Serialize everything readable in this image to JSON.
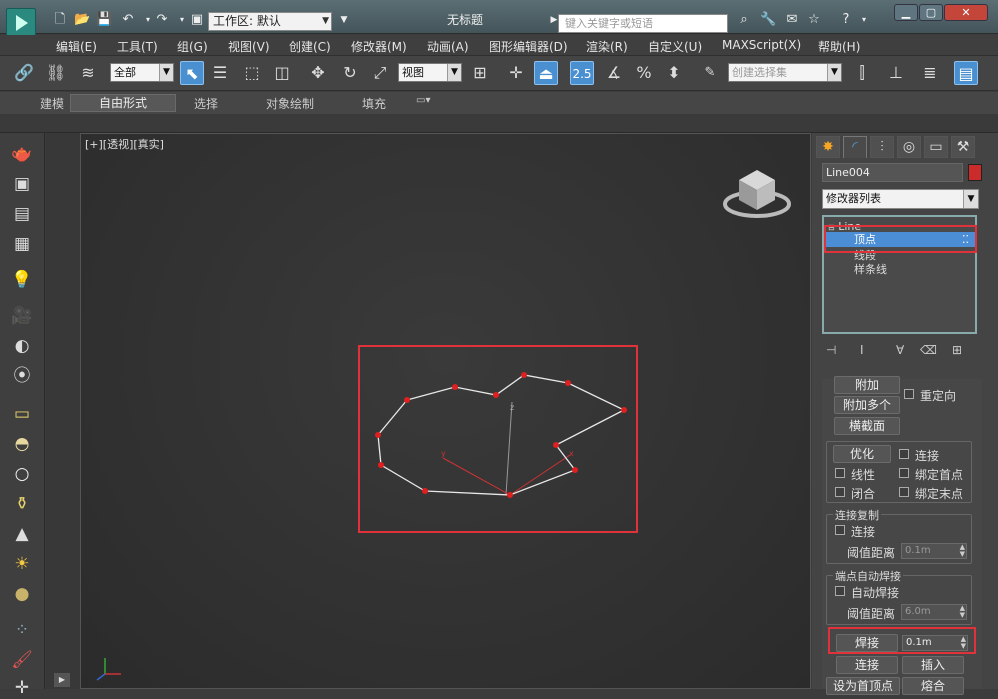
{
  "app": {
    "title": "无标题",
    "workspace_label": "工作区: 默认",
    "search_placeholder": "键入关键字或短语"
  },
  "menu": [
    "编辑(E)",
    "工具(T)",
    "组(G)",
    "视图(V)",
    "创建(C)",
    "修改器(M)",
    "动画(A)",
    "图形编辑器(D)",
    "渲染(R)",
    "自定义(U)",
    "MAXScript(X)",
    "帮助(H)"
  ],
  "toolbar": {
    "selection_filter": "全部",
    "reference_coord": "视图",
    "snap_value": "2.5",
    "named_selection": "创建选择集"
  },
  "ribbon": {
    "tabs": [
      "建模",
      "自由形式",
      "选择",
      "对象绘制",
      "填充"
    ],
    "selected_tab": "自由形式"
  },
  "viewport": {
    "label": "[+][透视][真实]"
  },
  "panel": {
    "object_name": "Line004",
    "object_color": "#cc2b2b",
    "modifier_list": "修改器列表",
    "stack": {
      "root": "Line",
      "items": [
        "顶点",
        "线段",
        "样条线"
      ],
      "selected": "顶点"
    },
    "geometry": {
      "attach_label": "附加",
      "reorient_label": "重定向",
      "attach_mult_label": "附加多个",
      "cross_section_label": "横截面",
      "refine_label": "优化",
      "connect_label": "连接",
      "linear_label": "线性",
      "bind_first_label": "绑定首点",
      "closed_label": "闭合",
      "bind_last_label": "绑定末点",
      "connect_copy": {
        "title": "连接复制",
        "connect_label": "连接",
        "threshold_label": "阈值距离",
        "threshold_value": "0.1m"
      },
      "end_point_weld": {
        "title": "端点自动焊接",
        "auto_weld_label": "自动焊接",
        "threshold_label": "阈值距离",
        "threshold_value": "6.0m"
      },
      "weld_label": "焊接",
      "weld_value": "0.1m",
      "connect_btn_label": "连接",
      "insert_label": "插入",
      "make_first_label": "设为首顶点",
      "fuse_label": "熔合"
    }
  }
}
